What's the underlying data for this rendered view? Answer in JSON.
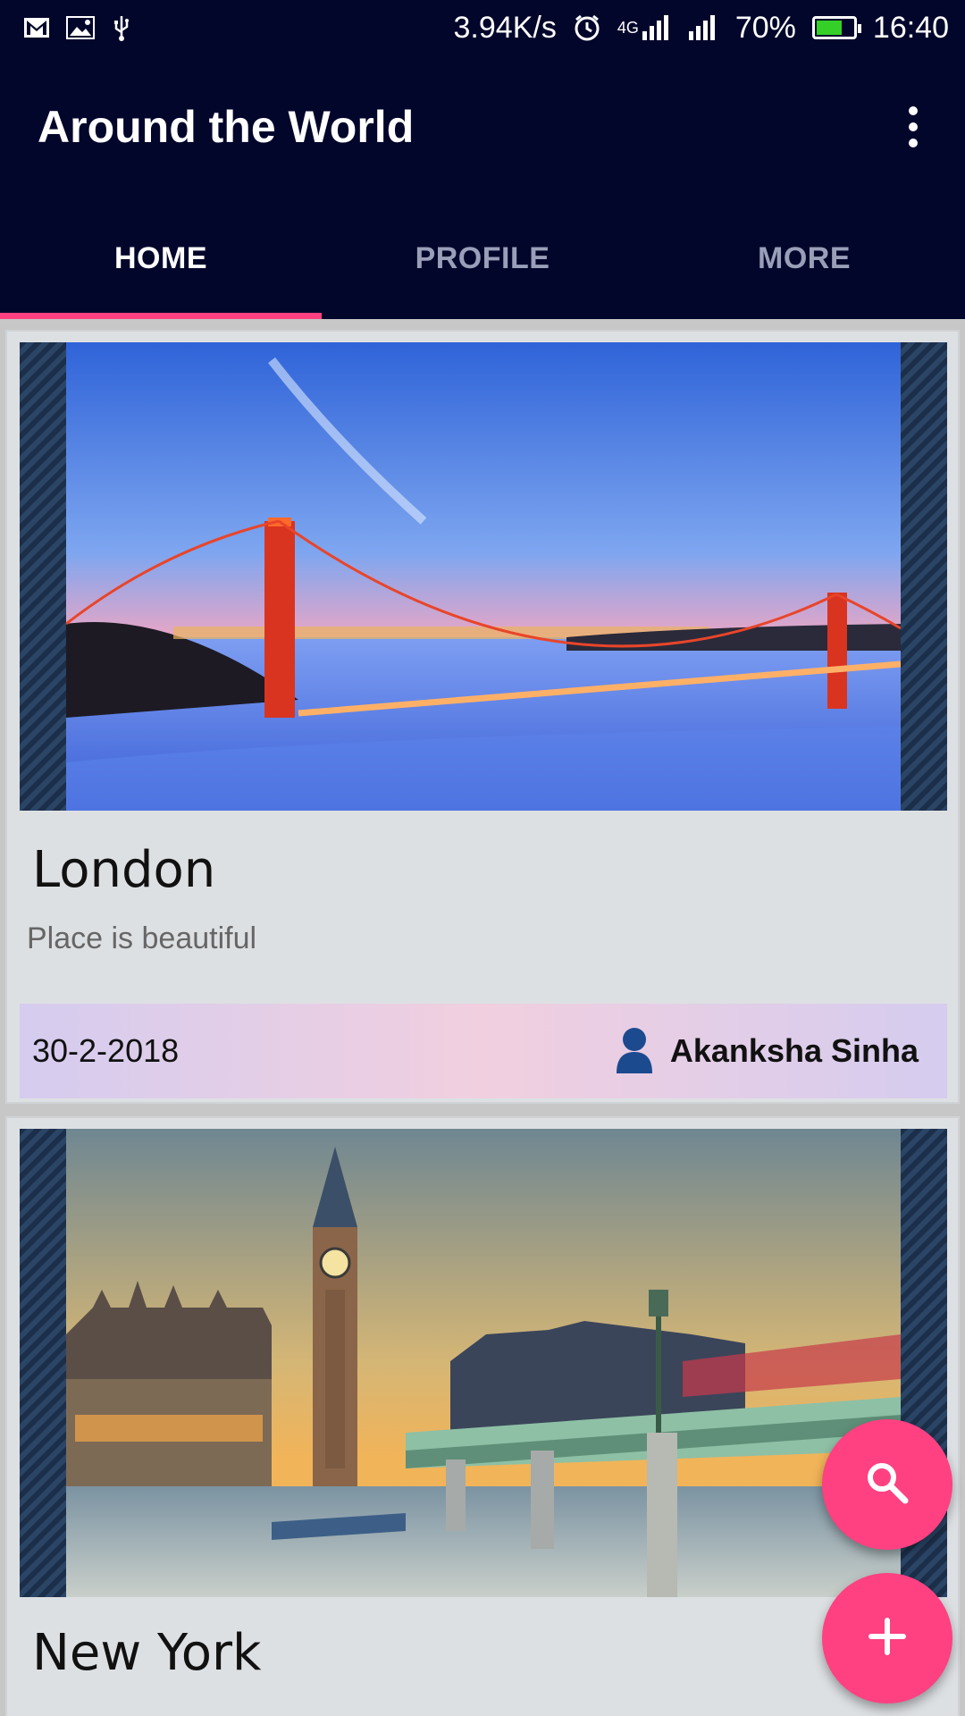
{
  "status_bar": {
    "net_speed": "3.94K/s",
    "network_type": "4G",
    "battery_percent": "70%",
    "battery_level": 0.7,
    "time": "16:40",
    "icons": [
      "gmail-icon",
      "image-icon",
      "usb-icon",
      "alarm-icon",
      "signal-icon",
      "signal-icon-2",
      "battery-icon"
    ]
  },
  "app_bar": {
    "title": "Around the World",
    "menu_icon": "more-vert-icon"
  },
  "tabs": [
    {
      "label": "HOME",
      "active": true
    },
    {
      "label": "PROFILE",
      "active": false
    },
    {
      "label": "MORE",
      "active": false
    }
  ],
  "cards": [
    {
      "title": "London",
      "description": "Place is beautiful",
      "date": "30-2-2018",
      "author": "Akanksha Sinha",
      "image": "golden-gate-bridge-image"
    },
    {
      "title": "New York",
      "image": "big-ben-westminster-image"
    }
  ],
  "fabs": {
    "search_icon": "search-icon",
    "add_icon": "add-icon"
  },
  "colors": {
    "primary_dark": "#03062b",
    "accent": "#ff4081",
    "card_bg": "#dde0e3"
  }
}
